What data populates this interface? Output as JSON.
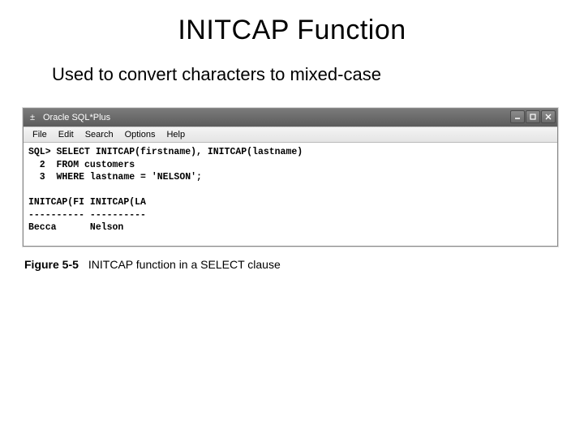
{
  "slide": {
    "title": "INITCAP Function",
    "subtitle": "Used to convert characters to mixed-case"
  },
  "window": {
    "app_title": "Oracle SQL*Plus",
    "menu": {
      "file": "File",
      "edit": "Edit",
      "search": "Search",
      "options": "Options",
      "help": "Help"
    }
  },
  "sql": {
    "line1": "SQL> SELECT INITCAP(firstname), INITCAP(lastname)",
    "line2": "  2  FROM customers",
    "line3": "  3  WHERE lastname = 'NELSON';",
    "blank": "",
    "header": "INITCAP(FI INITCAP(LA",
    "divider": "---------- ----------",
    "row1": "Becca      Nelson"
  },
  "figure": {
    "label": "Figure 5-5",
    "caption": "INITCAP function in a SELECT clause"
  }
}
